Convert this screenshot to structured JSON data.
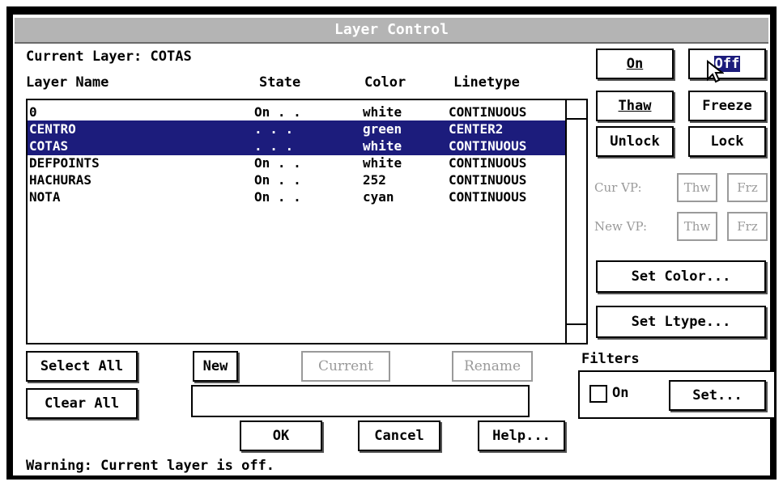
{
  "dialog": {
    "title": "Layer Control"
  },
  "current_layer": {
    "label": "Current Layer: COTAS"
  },
  "columns": {
    "name": "Layer Name",
    "state": "State",
    "color": "Color",
    "linetype": "Linetype"
  },
  "layers": [
    {
      "name": "0",
      "state": "On . .",
      "color": "white",
      "linetype": "CONTINUOUS",
      "selected": false
    },
    {
      "name": "CENTRO",
      "state": ". . .",
      "color": "green",
      "linetype": "CENTER2",
      "selected": true
    },
    {
      "name": "COTAS",
      "state": ". . .",
      "color": "white",
      "linetype": "CONTINUOUS",
      "selected": true
    },
    {
      "name": "DEFPOINTS",
      "state": "On . .",
      "color": "white",
      "linetype": "CONTINUOUS",
      "selected": false
    },
    {
      "name": "HACHURAS",
      "state": "On . .",
      "color": "252",
      "linetype": "CONTINUOUS",
      "selected": false
    },
    {
      "name": "NOTA",
      "state": "On . .",
      "color": "cyan",
      "linetype": "CONTINUOUS",
      "selected": false
    }
  ],
  "buttons": {
    "on": "On",
    "off": "Off",
    "thaw": "Thaw",
    "freeze": "Freeze",
    "unlock": "Unlock",
    "lock": "Lock",
    "set_color": "Set Color...",
    "set_ltype": "Set Ltype...",
    "select_all": "Select All",
    "clear_all": "Clear All",
    "new": "New",
    "current": "Current",
    "rename": "Rename",
    "ok": "OK",
    "cancel": "Cancel",
    "help": "Help..."
  },
  "viewport": {
    "cur_label": "Cur VP:",
    "new_label": "New VP:",
    "thw": "Thw",
    "frz": "Frz"
  },
  "filters": {
    "label": "Filters",
    "on_label": "On",
    "set": "Set...",
    "on_checked": false
  },
  "name_field": {
    "value": ""
  },
  "warning": "Warning: Current layer is off."
}
